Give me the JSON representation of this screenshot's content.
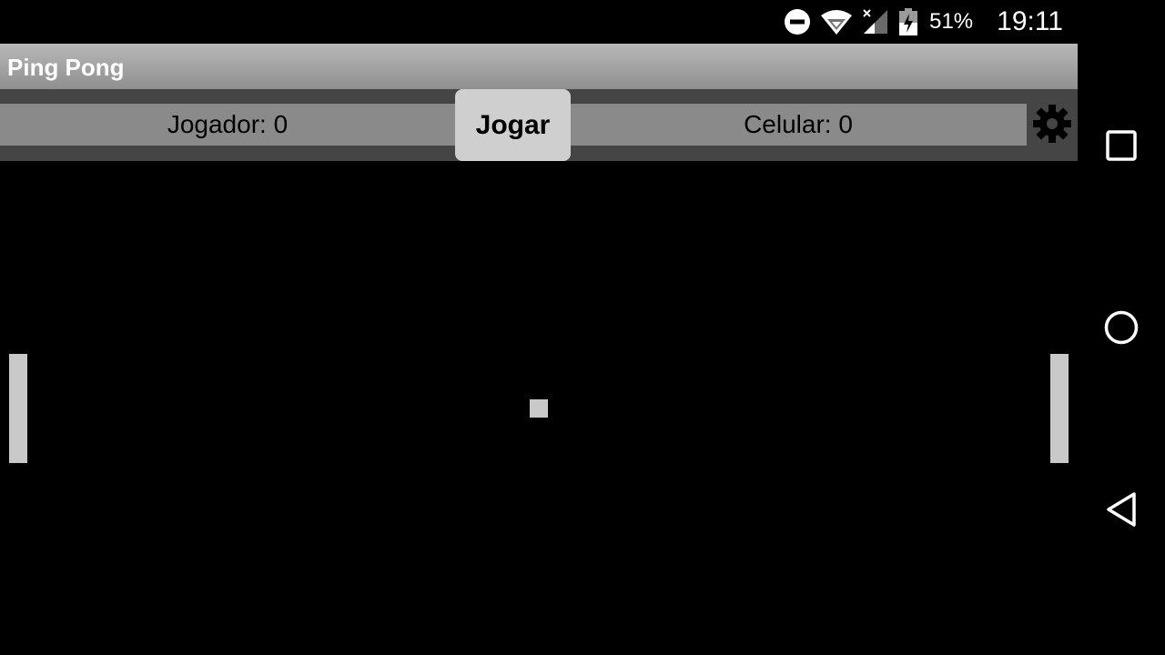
{
  "status_bar": {
    "battery_percent": "51%",
    "time": "19:11",
    "icons": [
      "do-not-disturb-icon",
      "wifi-icon",
      "cell-signal-icon",
      "battery-charging-icon"
    ]
  },
  "app_bar": {
    "title": "Ping Pong"
  },
  "scoreboard": {
    "player_label": "Jogador: 0",
    "phone_label": "Celular: 0",
    "play_button": "Jogar",
    "settings_icon": "gear-icon"
  },
  "nav_bar": {
    "icons": [
      "recent-apps-icon",
      "home-icon",
      "back-icon"
    ]
  },
  "colors": {
    "background": "#000000",
    "app_bar": "#9a9a9a",
    "score_strip": "#8a8a8a",
    "score_band": "#454545",
    "button": "#cfcfcf",
    "game_objects": "#c9c9c9"
  }
}
